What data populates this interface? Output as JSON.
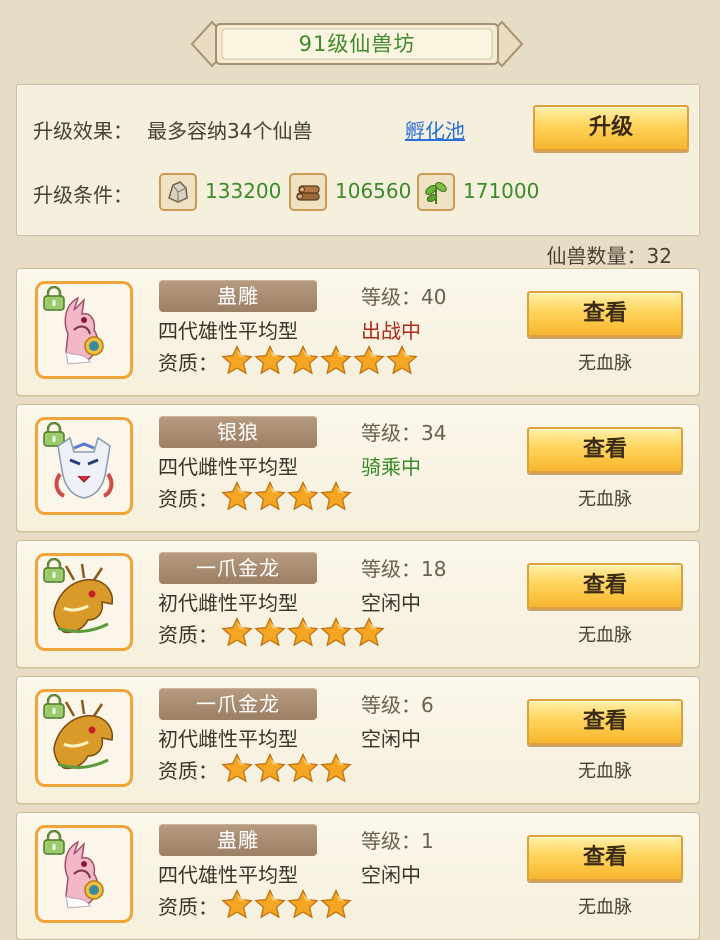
{
  "header": {
    "title": "91级仙兽坊"
  },
  "upgrade": {
    "effect_label": "升级效果：",
    "effect_value": "最多容纳34个仙兽",
    "pool_link": "孵化池",
    "button": "升级",
    "condition_label": "升级条件：",
    "resources": [
      {
        "icon": "ore-icon",
        "value": "133200"
      },
      {
        "icon": "wood-icon",
        "value": "106560"
      },
      {
        "icon": "herb-icon",
        "value": "171000"
      }
    ]
  },
  "pet_count": "仙兽数量：32",
  "colors": {
    "status_active": "#b02a1a",
    "status_riding": "#3a8a2a",
    "status_idle": "#3d3328",
    "star": "#f5a623"
  },
  "pets": [
    {
      "name": "蛊雕",
      "type": "四代雄性平均型",
      "grade_label": "资质：",
      "stars": 6,
      "level": "等级：40",
      "status": "出战中",
      "status_kind": "active",
      "button": "查看",
      "bloodline": "无血脉",
      "icon": "eagle-beast-icon"
    },
    {
      "name": "银狼",
      "type": "四代雌性平均型",
      "grade_label": "资质：",
      "stars": 4,
      "level": "等级：34",
      "status": "骑乘中",
      "status_kind": "riding",
      "button": "查看",
      "bloodline": "无血脉",
      "icon": "wolf-icon"
    },
    {
      "name": "一爪金龙",
      "type": "初代雌性平均型",
      "grade_label": "资质：",
      "stars": 5,
      "level": "等级：18",
      "status": "空闲中",
      "status_kind": "idle",
      "button": "查看",
      "bloodline": "无血脉",
      "icon": "dragon-icon"
    },
    {
      "name": "一爪金龙",
      "type": "初代雌性平均型",
      "grade_label": "资质：",
      "stars": 4,
      "level": "等级：6",
      "status": "空闲中",
      "status_kind": "idle",
      "button": "查看",
      "bloodline": "无血脉",
      "icon": "dragon-icon"
    },
    {
      "name": "蛊雕",
      "type": "四代雄性平均型",
      "grade_label": "资质：",
      "stars": 4,
      "level": "等级：1",
      "status": "空闲中",
      "status_kind": "idle",
      "button": "查看",
      "bloodline": "无血脉",
      "icon": "eagle-beast-icon"
    }
  ]
}
